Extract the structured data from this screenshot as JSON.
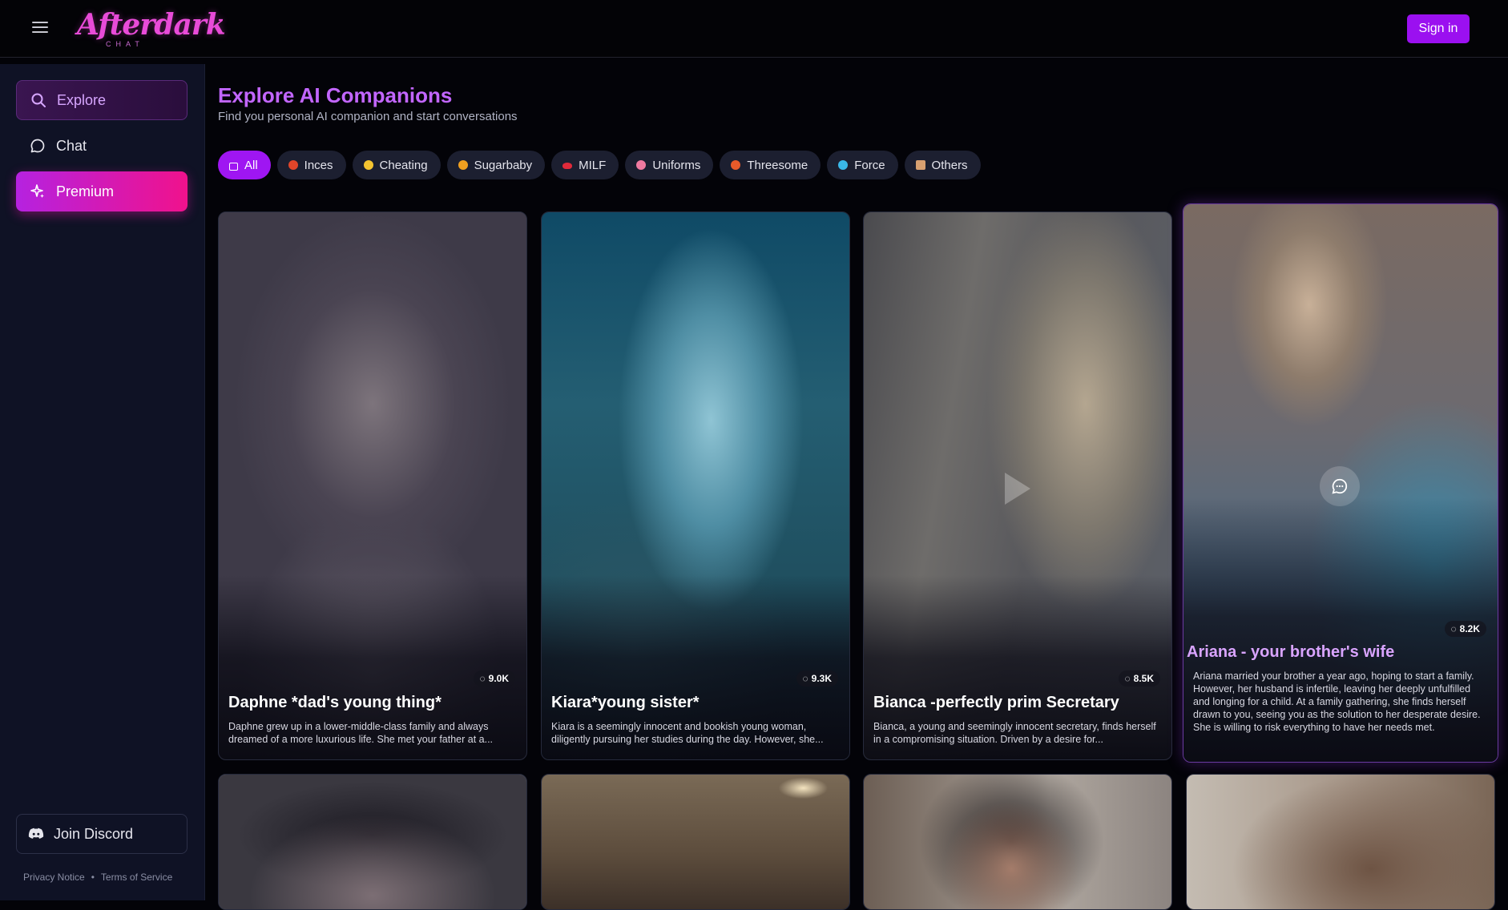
{
  "header": {
    "logo_main": "Afterdark",
    "logo_sub": "CHAT",
    "signin_label": "Sign in"
  },
  "sidebar": {
    "items": [
      {
        "label": "Explore",
        "icon": "search-icon"
      },
      {
        "label": "Chat",
        "icon": "chat-icon"
      },
      {
        "label": "Premium",
        "icon": "sparkle-icon"
      }
    ],
    "discord_label": "Join Discord",
    "privacy": "Privacy Notice",
    "separator": "•",
    "terms": "Terms of Service"
  },
  "main": {
    "title": "Explore AI Companions",
    "subtitle": "Find you personal AI companion and start conversations"
  },
  "categories": [
    {
      "label": "All",
      "active": true,
      "color": "#ffffff"
    },
    {
      "label": "Inces",
      "color": "#e0452a"
    },
    {
      "label": "Cheating",
      "color": "#f4c430"
    },
    {
      "label": "Sugarbaby",
      "color": "#f0a020"
    },
    {
      "label": "MILF",
      "color": "#e02a3a"
    },
    {
      "label": "Uniforms",
      "color": "#f07aa0"
    },
    {
      "label": "Threesome",
      "color": "#e85a2a"
    },
    {
      "label": "Force",
      "color": "#3ab8e8"
    },
    {
      "label": "Others",
      "color": "#d8a070"
    }
  ],
  "companions": [
    {
      "name": "Daphne *dad's young thing*",
      "count": "9.0K",
      "desc": "Daphne grew up in a lower-middle-class family and always dreamed of a more luxurious life. She met your father at a..."
    },
    {
      "name": "Kiara*young sister*",
      "count": "9.3K",
      "desc": "Kiara is a seemingly innocent and bookish young woman, diligently pursuing her studies during the day. However, she..."
    },
    {
      "name": "Bianca -perfectly prim Secretary",
      "count": "8.5K",
      "desc": "Bianca, a young and seemingly innocent secretary, finds herself in a compromising situation. Driven by a desire for..."
    },
    {
      "name": "Ariana - your brother's wife",
      "count": "8.2K",
      "desc": "Ariana married your brother a year ago, hoping to start a family. However, her husband is infertile, leaving her deeply unfulfilled and longing for a child. At a family gathering, she finds herself drawn to you, seeing you as the solution to her desperate desire. She is willing to risk everything to have her needs met."
    }
  ],
  "colors": {
    "accent": "#9f16f2",
    "title": "#c266ff",
    "premium_start": "#b522e0",
    "premium_end": "#f0128c"
  }
}
